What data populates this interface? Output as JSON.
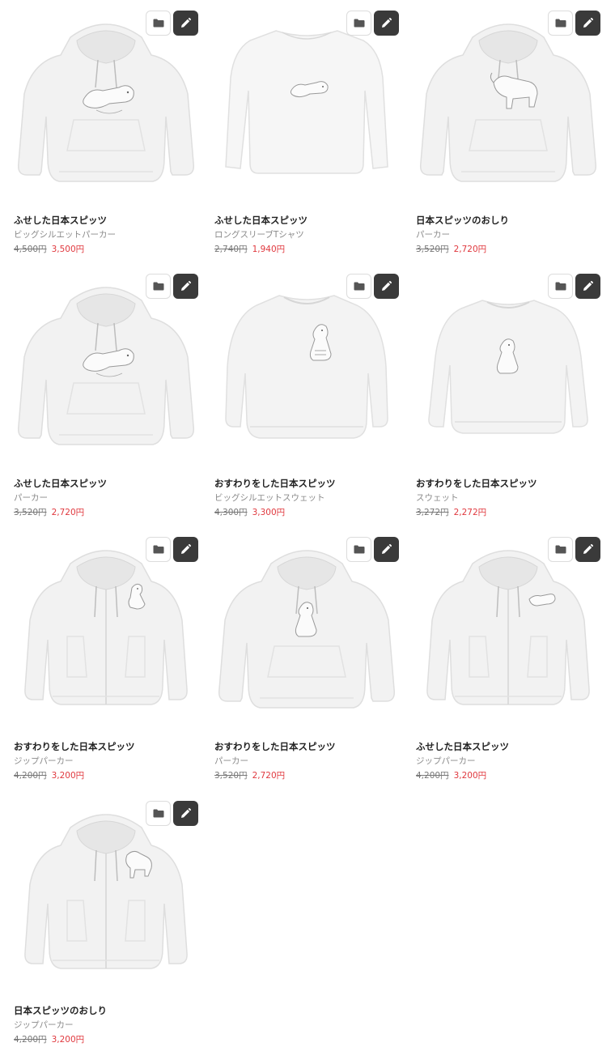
{
  "icons": {
    "collection": "folder-icon",
    "edit": "pencil-icon"
  },
  "colors": {
    "sale_price": "#e0383e",
    "original_price": "#777777",
    "edit_button": "#3a3a3a"
  },
  "products": [
    {
      "title": "ふせした日本スピッツ",
      "type": "ビッグシルエットパーカー",
      "original_price": "4,500円",
      "sale_price": "3,500円",
      "garment": "hoodie"
    },
    {
      "title": "ふせした日本スピッツ",
      "type": "ロングスリーブTシャツ",
      "original_price": "2,740円",
      "sale_price": "1,940円",
      "garment": "longtee"
    },
    {
      "title": "日本スピッツのおしり",
      "type": "パーカー",
      "original_price": "3,520円",
      "sale_price": "2,720円",
      "garment": "hoodie"
    },
    {
      "title": "ふせした日本スピッツ",
      "type": "パーカー",
      "original_price": "3,520円",
      "sale_price": "2,720円",
      "garment": "hoodie"
    },
    {
      "title": "おすわりをした日本スピッツ",
      "type": "ビッグシルエットスウェット",
      "original_price": "4,300円",
      "sale_price": "3,300円",
      "garment": "sweat"
    },
    {
      "title": "おすわりをした日本スピッツ",
      "type": "スウェット",
      "original_price": "3,272円",
      "sale_price": "2,272円",
      "garment": "sweat"
    },
    {
      "title": "おすわりをした日本スピッツ",
      "type": "ジップパーカー",
      "original_price": "4,200円",
      "sale_price": "3,200円",
      "garment": "zip"
    },
    {
      "title": "おすわりをした日本スピッツ",
      "type": "パーカー",
      "original_price": "3,520円",
      "sale_price": "2,720円",
      "garment": "hoodie"
    },
    {
      "title": "ふせした日本スピッツ",
      "type": "ジップパーカー",
      "original_price": "4,200円",
      "sale_price": "3,200円",
      "garment": "zip"
    },
    {
      "title": "日本スピッツのおしり",
      "type": "ジップパーカー",
      "original_price": "4,200円",
      "sale_price": "3,200円",
      "garment": "zip"
    }
  ]
}
